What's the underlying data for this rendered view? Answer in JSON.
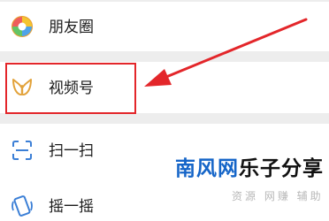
{
  "menu": {
    "items": [
      {
        "label": "朋友圈",
        "icon": "moments-icon"
      },
      {
        "label": "视频号",
        "icon": "channels-icon"
      },
      {
        "label": "扫一扫",
        "icon": "scan-icon"
      },
      {
        "label": "摇一摇",
        "icon": "shake-icon"
      }
    ]
  },
  "annotation": {
    "highlight_color": "#e3262a"
  },
  "watermark": {
    "part1": "南风网",
    "part2": "乐子分享",
    "subtitle": "资源 网赚 辅助"
  }
}
